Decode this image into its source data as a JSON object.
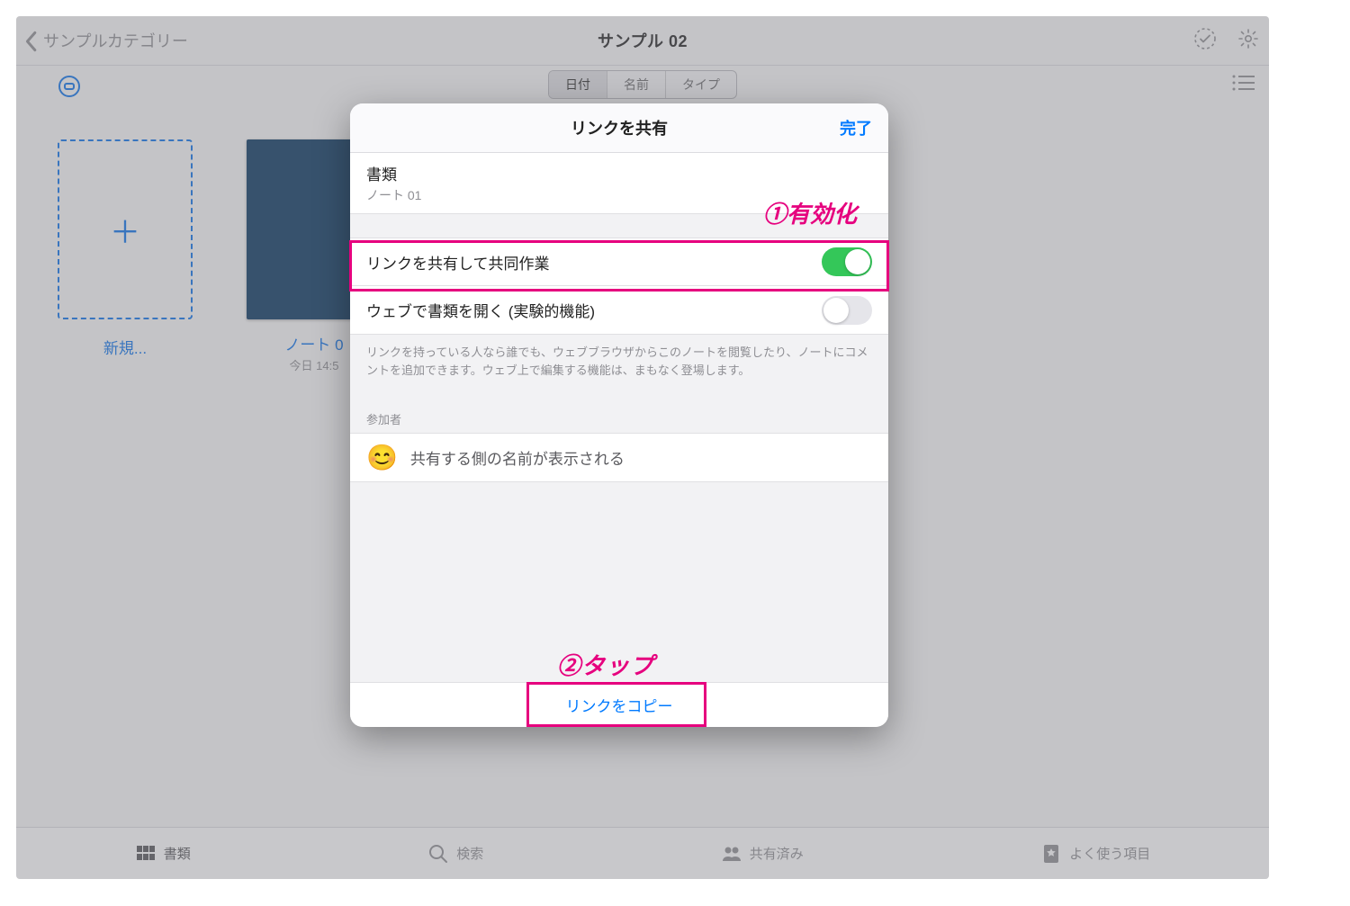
{
  "header": {
    "back_label": "サンプルカテゴリー",
    "title": "サンプル 02"
  },
  "seg": {
    "items": [
      "日付",
      "名前",
      "タイプ"
    ],
    "active_index": 0
  },
  "grid": {
    "new_label": "新規...",
    "note": {
      "name": "ノート 0",
      "time": "今日 14:5"
    }
  },
  "modal": {
    "title": "リンクを共有",
    "done": "完了",
    "doc": {
      "heading": "書類",
      "name": "ノート 01"
    },
    "rows": {
      "share_collab": {
        "label": "リンクを共有して共同作業",
        "on": true
      },
      "open_web": {
        "label": "ウェブで書類を開く (実験的機能)",
        "on": false
      }
    },
    "help": "リンクを持っている人なら誰でも、ウェブブラウザからこのノートを閲覧したり、ノートにコメントを追加できます。ウェブ上で編集する機能は、まもなく登場します。",
    "participants_header": "参加者",
    "participant_placeholder": "共有する側の名前が表示される",
    "copy_link": "リンクをコピー"
  },
  "tabs": {
    "items": [
      "書類",
      "検索",
      "共有済み",
      "よく使う項目"
    ],
    "active_index": 0
  },
  "annotations": {
    "a1": "①有効化",
    "a2": "②タップ"
  }
}
